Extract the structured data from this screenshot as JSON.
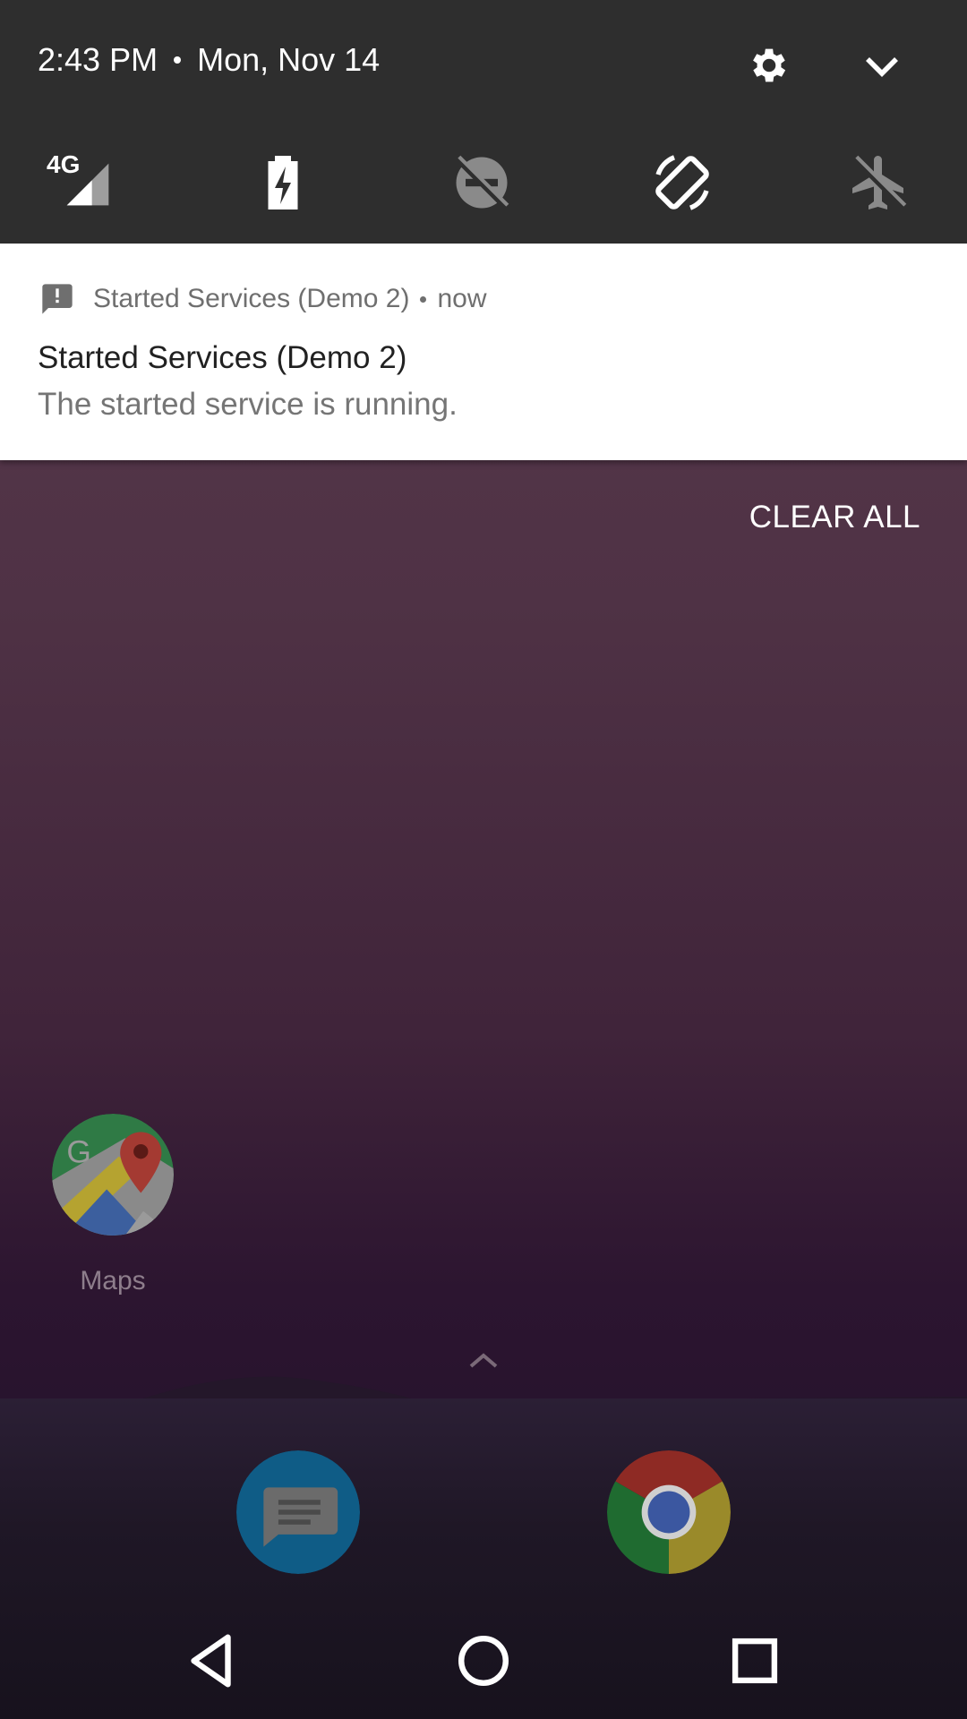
{
  "quick_settings": {
    "time": "2:43 PM",
    "date": "Mon, Nov 14",
    "network_label": "4G",
    "tiles": [
      {
        "name": "cellular-signal",
        "icon": "signal-4g-icon"
      },
      {
        "name": "battery-saver",
        "icon": "battery-charging-icon"
      },
      {
        "name": "do-not-disturb",
        "icon": "dnd-off-icon"
      },
      {
        "name": "auto-rotate",
        "icon": "rotate-icon"
      },
      {
        "name": "airplane-mode",
        "icon": "airplane-off-icon"
      }
    ]
  },
  "notification": {
    "app_name": "Started Services (Demo 2)",
    "time": "now",
    "title": "Started Services (Demo 2)",
    "text": "The started service is running."
  },
  "clear_all_label": "CLEAR ALL",
  "home": {
    "apps": [
      {
        "label": "Maps",
        "icon": "google-maps-icon"
      }
    ],
    "dock": [
      {
        "icon": "messages-icon"
      },
      {
        "icon": "chrome-icon"
      }
    ]
  },
  "colors": {
    "qs_bg": "#2e2e2e",
    "notif_bg": "#ffffff",
    "wallpaper_top": "#5a3a4e",
    "wallpaper_bottom": "#1d1028"
  }
}
